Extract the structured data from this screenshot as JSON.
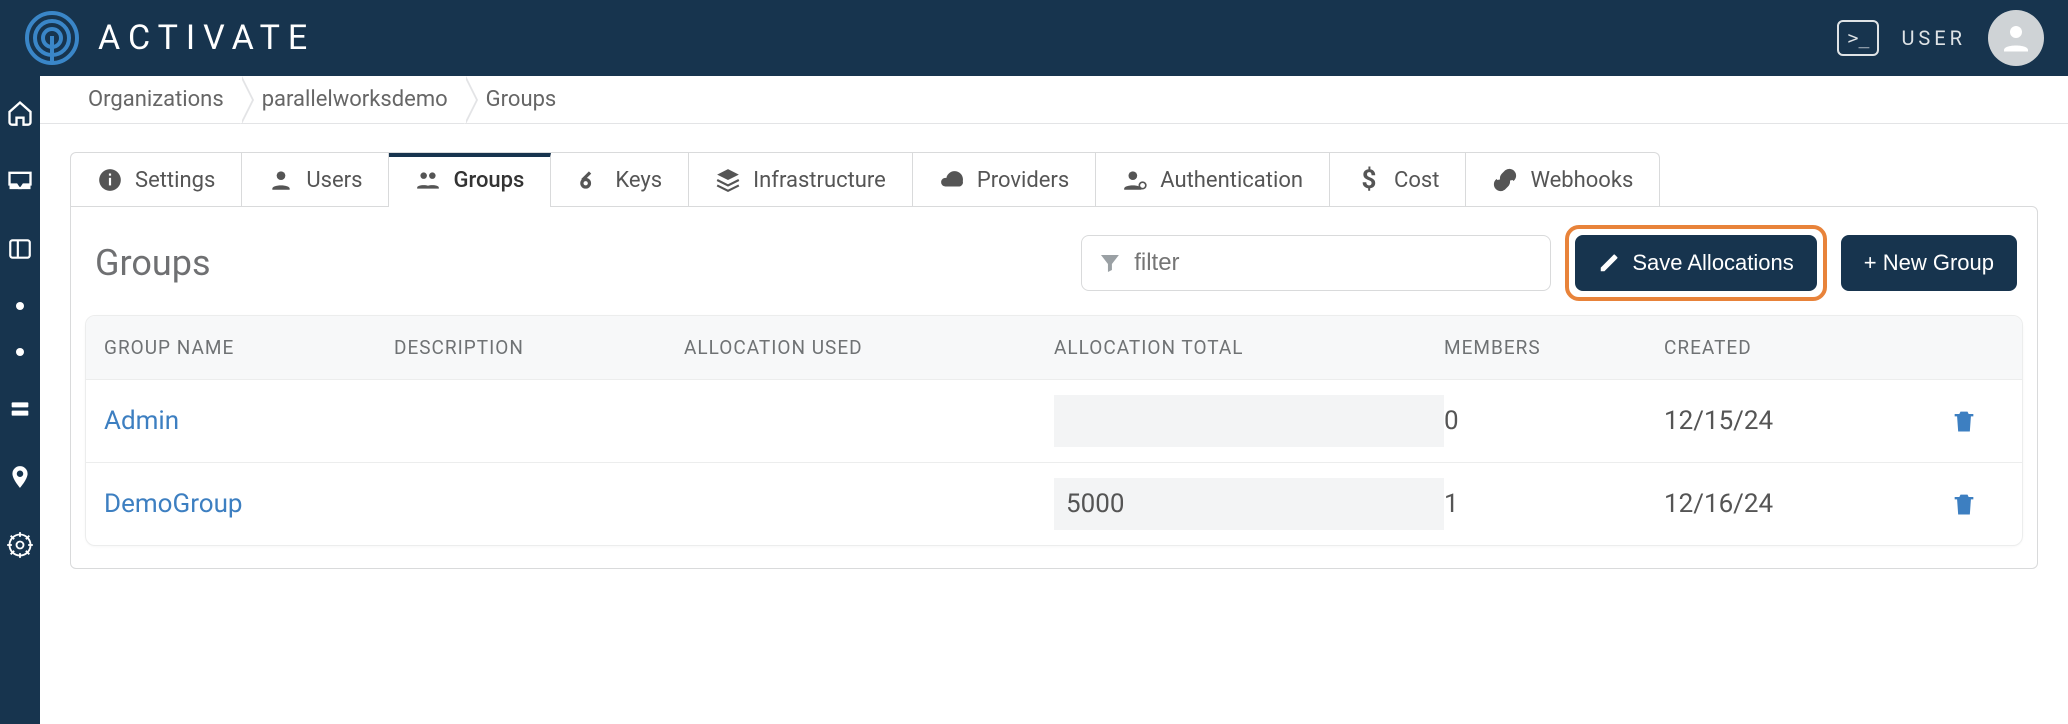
{
  "brand": {
    "name": "ACTIVATE"
  },
  "topbar": {
    "user_label": "USER",
    "terminal_glyph": ">_"
  },
  "breadcrumb": [
    "Organizations",
    "parallelworksdemo",
    "Groups"
  ],
  "tabs": [
    {
      "id": "settings",
      "label": "Settings",
      "icon": "info"
    },
    {
      "id": "users",
      "label": "Users",
      "icon": "user"
    },
    {
      "id": "groups",
      "label": "Groups",
      "icon": "group",
      "active": true
    },
    {
      "id": "keys",
      "label": "Keys",
      "icon": "key"
    },
    {
      "id": "infrastructure",
      "label": "Infrastructure",
      "icon": "layers"
    },
    {
      "id": "providers",
      "label": "Providers",
      "icon": "cloud"
    },
    {
      "id": "authentication",
      "label": "Authentication",
      "icon": "person-gear"
    },
    {
      "id": "cost",
      "label": "Cost",
      "icon": "dollar"
    },
    {
      "id": "webhooks",
      "label": "Webhooks",
      "icon": "link"
    }
  ],
  "panel": {
    "title": "Groups",
    "filter_placeholder": "filter",
    "save_button": "Save Allocations",
    "new_button": "+ New Group"
  },
  "table": {
    "headers": {
      "name": "GROUP NAME",
      "description": "DESCRIPTION",
      "alloc_used": "ALLOCATION USED",
      "alloc_total": "ALLOCATION TOTAL",
      "members": "MEMBERS",
      "created": "CREATED"
    },
    "rows": [
      {
        "name": "Admin",
        "description": "",
        "alloc_used": "",
        "alloc_total": "",
        "members": "0",
        "created": "12/15/24"
      },
      {
        "name": "DemoGroup",
        "description": "",
        "alloc_used": "",
        "alloc_total": "5000",
        "members": "1",
        "created": "12/16/24"
      }
    ]
  }
}
